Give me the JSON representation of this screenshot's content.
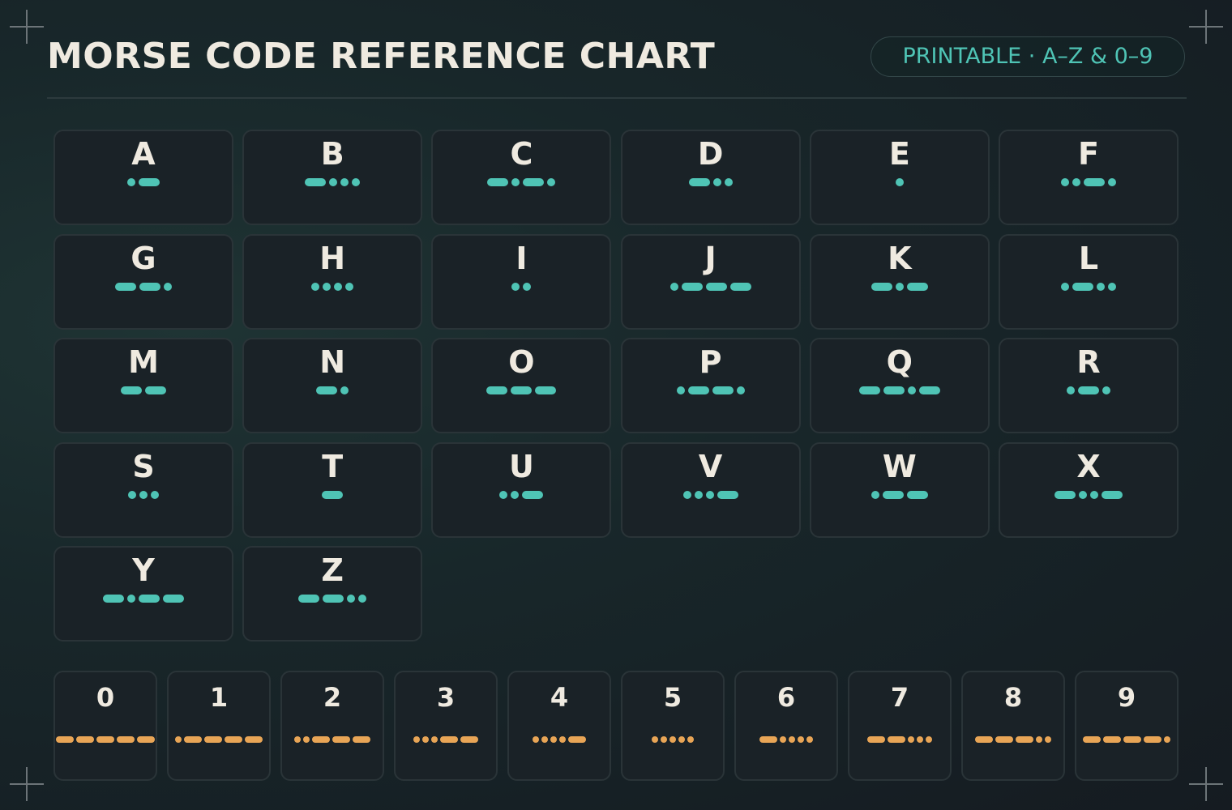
{
  "title": "MORSE CODE REFERENCE CHART",
  "badge": "PRINTABLE · A–Z & 0–9",
  "colors": {
    "letter_symbols": "#4fc4b5",
    "digit_symbols": "#e8a556",
    "text": "#efeae0",
    "card_bg": "#1a2227",
    "card_border": "#2a3438"
  },
  "letters": [
    {
      "char": "A",
      "code": ".-"
    },
    {
      "char": "B",
      "code": "-..."
    },
    {
      "char": "C",
      "code": "-.-."
    },
    {
      "char": "D",
      "code": "-.."
    },
    {
      "char": "E",
      "code": "."
    },
    {
      "char": "F",
      "code": "..-."
    },
    {
      "char": "G",
      "code": "--."
    },
    {
      "char": "H",
      "code": "...."
    },
    {
      "char": "I",
      "code": ".."
    },
    {
      "char": "J",
      "code": ".---"
    },
    {
      "char": "K",
      "code": "-.-"
    },
    {
      "char": "L",
      "code": ".-.."
    },
    {
      "char": "M",
      "code": "--"
    },
    {
      "char": "N",
      "code": "-."
    },
    {
      "char": "O",
      "code": "---"
    },
    {
      "char": "P",
      "code": ".--."
    },
    {
      "char": "Q",
      "code": "--.-"
    },
    {
      "char": "R",
      "code": ".-."
    },
    {
      "char": "S",
      "code": "..."
    },
    {
      "char": "T",
      "code": "-"
    },
    {
      "char": "U",
      "code": "..-"
    },
    {
      "char": "V",
      "code": "...-"
    },
    {
      "char": "W",
      "code": ".--"
    },
    {
      "char": "X",
      "code": "-..-"
    },
    {
      "char": "Y",
      "code": "-.--"
    },
    {
      "char": "Z",
      "code": "--.."
    }
  ],
  "digits": [
    {
      "char": "0",
      "code": "-----"
    },
    {
      "char": "1",
      "code": ".----"
    },
    {
      "char": "2",
      "code": "..---"
    },
    {
      "char": "3",
      "code": "...--"
    },
    {
      "char": "4",
      "code": "....-"
    },
    {
      "char": "5",
      "code": "....."
    },
    {
      "char": "6",
      "code": "-...."
    },
    {
      "char": "7",
      "code": "--..."
    },
    {
      "char": "8",
      "code": "---.."
    },
    {
      "char": "9",
      "code": "----."
    }
  ]
}
